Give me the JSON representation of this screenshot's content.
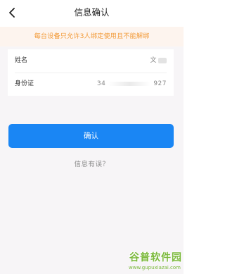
{
  "nav": {
    "title": "信息确认",
    "back_icon": "chevron-left-icon"
  },
  "notice": {
    "text": "每台设备只允许3人绑定使用且不能解绑",
    "color": "#f29a38"
  },
  "info": {
    "name_label": "姓名",
    "name_value": "文",
    "id_label": "身份证",
    "id_prefix": "34",
    "id_suffix": "927"
  },
  "confirm_button": {
    "label": "确认",
    "color": "#1a86f4"
  },
  "help_link": {
    "label": "信息有误？"
  },
  "watermark": {
    "main": "谷普软件园",
    "url": "www.gupuxiazai.com"
  }
}
